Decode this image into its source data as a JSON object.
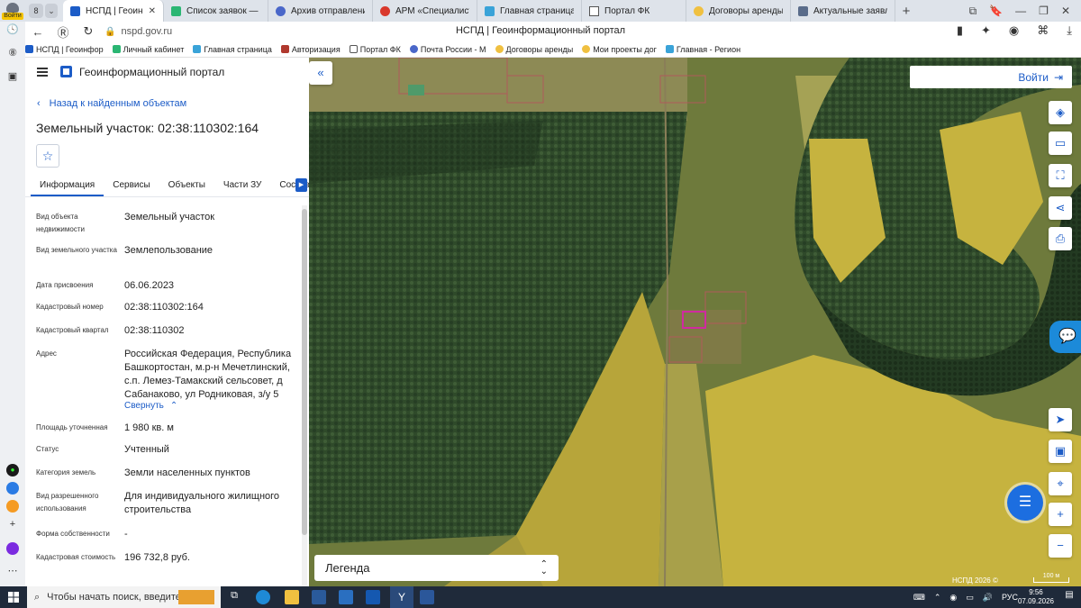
{
  "browser": {
    "profile_label": "Войти",
    "tab_count": "8",
    "tabs": [
      {
        "label": "НСПД | Геоинформа",
        "active": true
      },
      {
        "label": "Список заявок — Техн"
      },
      {
        "label": "Архив отправлений —"
      },
      {
        "label": "АРМ «Специалист»"
      },
      {
        "label": "Главная страница"
      },
      {
        "label": "Портал ФК"
      },
      {
        "label": "Договоры аренды зем"
      },
      {
        "label": "Актуальные заявления"
      }
    ],
    "url": "nspd.gov.ru",
    "page_title": "НСПД | Геоинформационный портал",
    "bookmarks": [
      "НСПД | Геоинфор",
      "Личный кабинет",
      "Главная страница",
      "Авторизация",
      "Портал ФК",
      "Почта России - М",
      "Договоры аренды",
      "Мои проекты дог",
      "Главная - Регион"
    ]
  },
  "panel": {
    "portal_name": "Геоинформационный портал",
    "back_link": "Назад к найденным объектам",
    "object_title": "Земельный участок: 02:38:110302:164",
    "tabs": [
      "Информация",
      "Сервисы",
      "Объекты",
      "Части ЗУ",
      "Состав"
    ],
    "properties": [
      {
        "label": "Вид объекта недвижимости",
        "value": "Земельный участок"
      },
      {
        "label": "Вид земельного участка",
        "value": "Землепользование"
      },
      {
        "label": "Дата присвоения",
        "value": "06.06.2023"
      },
      {
        "label": "Кадастровый номер",
        "value": "02:38:110302:164"
      },
      {
        "label": "Кадастровый квартал",
        "value": "02:38:110302"
      },
      {
        "label": "Адрес",
        "value": "Российская Федерация, Республика Башкортостан, м.р-н Мечетлинский, с.п. Лемез-Тамакский сельсовет, д Сабанаково, ул Родниковая, з/у 5"
      },
      {
        "label": "Площадь уточненная",
        "value": "1 980 кв. м"
      },
      {
        "label": "Статус",
        "value": "Учтенный"
      },
      {
        "label": "Категория земель",
        "value": "Земли населенных пунктов"
      },
      {
        "label": "Вид разрешенного использования",
        "value": "Для индивидуального жилищного строительства"
      },
      {
        "label": "Форма собственности",
        "value": "-"
      },
      {
        "label": "Кадастровая стоимость",
        "value": "196 732,8 руб."
      }
    ],
    "collapse_label": "Свернуть"
  },
  "map": {
    "login_label": "Войти",
    "legend_label": "Легенда",
    "copyright": "НСПД 2026 ©",
    "scale_label": "100 м"
  },
  "taskbar": {
    "search_placeholder": "Чтобы начать поиск, введите",
    "lang": "РУС",
    "time": "9:56",
    "date": "07.09.2026"
  },
  "colors": {
    "accent": "#1c5cc7",
    "parcel_highlight": "#d02aa0",
    "field_overlay": "#c9b33a"
  }
}
